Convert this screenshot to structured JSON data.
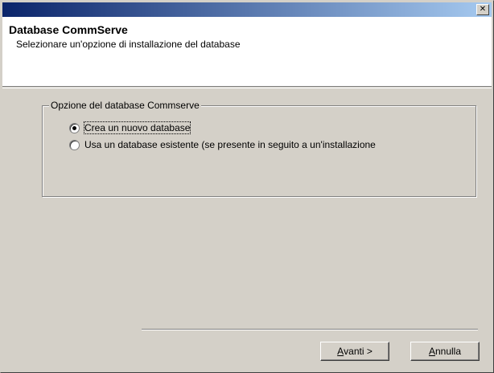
{
  "titlebar": {
    "close_glyph": "✕"
  },
  "header": {
    "title": "Database CommServe",
    "subtitle": "Selezionare un'opzione di installazione del database"
  },
  "group": {
    "legend": "Opzione del database Commserve",
    "options": [
      {
        "label": "Crea un nuovo database",
        "checked": true
      },
      {
        "label": "Usa un database esistente (se presente in seguito a un'installazione",
        "checked": false
      }
    ]
  },
  "buttons": {
    "next": {
      "mnemonic": "A",
      "rest": "vanti >"
    },
    "cancel": {
      "mnemonic": "A",
      "rest": "nnulla"
    }
  }
}
